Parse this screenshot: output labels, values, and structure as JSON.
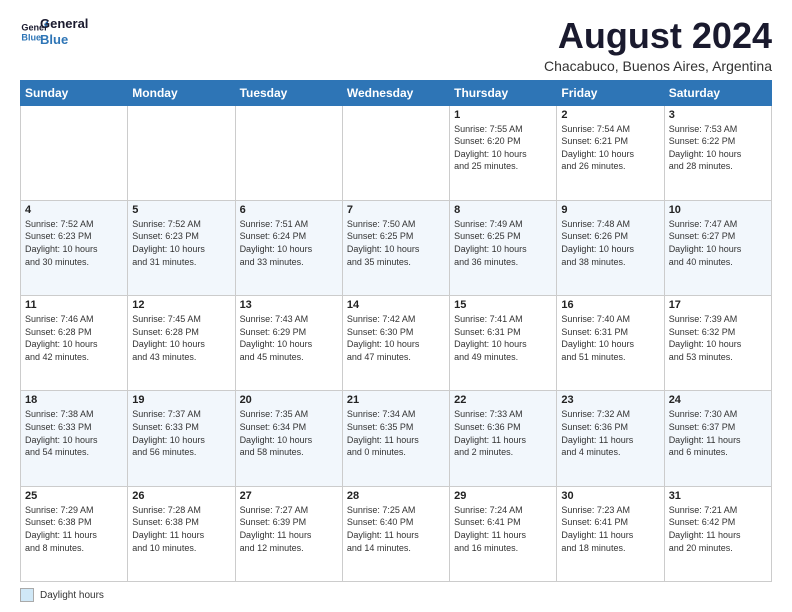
{
  "header": {
    "logo_line1": "General",
    "logo_line2": "Blue",
    "month_year": "August 2024",
    "location": "Chacabuco, Buenos Aires, Argentina"
  },
  "footer": {
    "daylight_label": "Daylight hours"
  },
  "days_of_week": [
    "Sunday",
    "Monday",
    "Tuesday",
    "Wednesday",
    "Thursday",
    "Friday",
    "Saturday"
  ],
  "weeks": [
    [
      {
        "day": "",
        "info": ""
      },
      {
        "day": "",
        "info": ""
      },
      {
        "day": "",
        "info": ""
      },
      {
        "day": "",
        "info": ""
      },
      {
        "day": "1",
        "info": "Sunrise: 7:55 AM\nSunset: 6:20 PM\nDaylight: 10 hours\nand 25 minutes."
      },
      {
        "day": "2",
        "info": "Sunrise: 7:54 AM\nSunset: 6:21 PM\nDaylight: 10 hours\nand 26 minutes."
      },
      {
        "day": "3",
        "info": "Sunrise: 7:53 AM\nSunset: 6:22 PM\nDaylight: 10 hours\nand 28 minutes."
      }
    ],
    [
      {
        "day": "4",
        "info": "Sunrise: 7:52 AM\nSunset: 6:23 PM\nDaylight: 10 hours\nand 30 minutes."
      },
      {
        "day": "5",
        "info": "Sunrise: 7:52 AM\nSunset: 6:23 PM\nDaylight: 10 hours\nand 31 minutes."
      },
      {
        "day": "6",
        "info": "Sunrise: 7:51 AM\nSunset: 6:24 PM\nDaylight: 10 hours\nand 33 minutes."
      },
      {
        "day": "7",
        "info": "Sunrise: 7:50 AM\nSunset: 6:25 PM\nDaylight: 10 hours\nand 35 minutes."
      },
      {
        "day": "8",
        "info": "Sunrise: 7:49 AM\nSunset: 6:25 PM\nDaylight: 10 hours\nand 36 minutes."
      },
      {
        "day": "9",
        "info": "Sunrise: 7:48 AM\nSunset: 6:26 PM\nDaylight: 10 hours\nand 38 minutes."
      },
      {
        "day": "10",
        "info": "Sunrise: 7:47 AM\nSunset: 6:27 PM\nDaylight: 10 hours\nand 40 minutes."
      }
    ],
    [
      {
        "day": "11",
        "info": "Sunrise: 7:46 AM\nSunset: 6:28 PM\nDaylight: 10 hours\nand 42 minutes."
      },
      {
        "day": "12",
        "info": "Sunrise: 7:45 AM\nSunset: 6:28 PM\nDaylight: 10 hours\nand 43 minutes."
      },
      {
        "day": "13",
        "info": "Sunrise: 7:43 AM\nSunset: 6:29 PM\nDaylight: 10 hours\nand 45 minutes."
      },
      {
        "day": "14",
        "info": "Sunrise: 7:42 AM\nSunset: 6:30 PM\nDaylight: 10 hours\nand 47 minutes."
      },
      {
        "day": "15",
        "info": "Sunrise: 7:41 AM\nSunset: 6:31 PM\nDaylight: 10 hours\nand 49 minutes."
      },
      {
        "day": "16",
        "info": "Sunrise: 7:40 AM\nSunset: 6:31 PM\nDaylight: 10 hours\nand 51 minutes."
      },
      {
        "day": "17",
        "info": "Sunrise: 7:39 AM\nSunset: 6:32 PM\nDaylight: 10 hours\nand 53 minutes."
      }
    ],
    [
      {
        "day": "18",
        "info": "Sunrise: 7:38 AM\nSunset: 6:33 PM\nDaylight: 10 hours\nand 54 minutes."
      },
      {
        "day": "19",
        "info": "Sunrise: 7:37 AM\nSunset: 6:33 PM\nDaylight: 10 hours\nand 56 minutes."
      },
      {
        "day": "20",
        "info": "Sunrise: 7:35 AM\nSunset: 6:34 PM\nDaylight: 10 hours\nand 58 minutes."
      },
      {
        "day": "21",
        "info": "Sunrise: 7:34 AM\nSunset: 6:35 PM\nDaylight: 11 hours\nand 0 minutes."
      },
      {
        "day": "22",
        "info": "Sunrise: 7:33 AM\nSunset: 6:36 PM\nDaylight: 11 hours\nand 2 minutes."
      },
      {
        "day": "23",
        "info": "Sunrise: 7:32 AM\nSunset: 6:36 PM\nDaylight: 11 hours\nand 4 minutes."
      },
      {
        "day": "24",
        "info": "Sunrise: 7:30 AM\nSunset: 6:37 PM\nDaylight: 11 hours\nand 6 minutes."
      }
    ],
    [
      {
        "day": "25",
        "info": "Sunrise: 7:29 AM\nSunset: 6:38 PM\nDaylight: 11 hours\nand 8 minutes."
      },
      {
        "day": "26",
        "info": "Sunrise: 7:28 AM\nSunset: 6:38 PM\nDaylight: 11 hours\nand 10 minutes."
      },
      {
        "day": "27",
        "info": "Sunrise: 7:27 AM\nSunset: 6:39 PM\nDaylight: 11 hours\nand 12 minutes."
      },
      {
        "day": "28",
        "info": "Sunrise: 7:25 AM\nSunset: 6:40 PM\nDaylight: 11 hours\nand 14 minutes."
      },
      {
        "day": "29",
        "info": "Sunrise: 7:24 AM\nSunset: 6:41 PM\nDaylight: 11 hours\nand 16 minutes."
      },
      {
        "day": "30",
        "info": "Sunrise: 7:23 AM\nSunset: 6:41 PM\nDaylight: 11 hours\nand 18 minutes."
      },
      {
        "day": "31",
        "info": "Sunrise: 7:21 AM\nSunset: 6:42 PM\nDaylight: 11 hours\nand 20 minutes."
      }
    ]
  ]
}
